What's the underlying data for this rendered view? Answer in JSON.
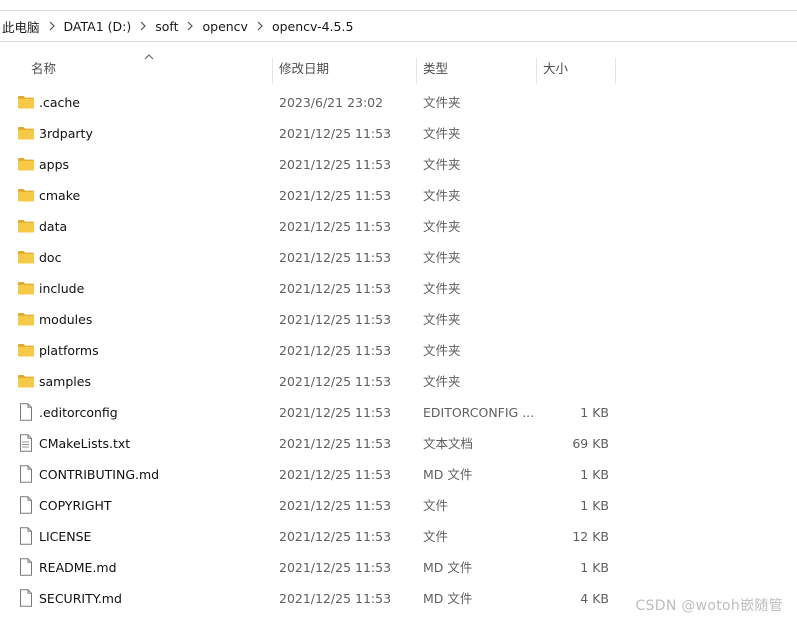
{
  "breadcrumb": {
    "items": [
      "此电脑",
      "DATA1 (D:)",
      "soft",
      "opencv",
      "opencv-4.5.5"
    ]
  },
  "columns": {
    "name": "名称",
    "date": "修改日期",
    "type": "类型",
    "size": "大小"
  },
  "files": [
    {
      "name": ".cache",
      "date": "2023/6/21 23:02",
      "type": "文件夹",
      "size": "",
      "icon": "folder-icon"
    },
    {
      "name": "3rdparty",
      "date": "2021/12/25 11:53",
      "type": "文件夹",
      "size": "",
      "icon": "folder-icon"
    },
    {
      "name": "apps",
      "date": "2021/12/25 11:53",
      "type": "文件夹",
      "size": "",
      "icon": "folder-icon"
    },
    {
      "name": "cmake",
      "date": "2021/12/25 11:53",
      "type": "文件夹",
      "size": "",
      "icon": "folder-icon"
    },
    {
      "name": "data",
      "date": "2021/12/25 11:53",
      "type": "文件夹",
      "size": "",
      "icon": "folder-icon"
    },
    {
      "name": "doc",
      "date": "2021/12/25 11:53",
      "type": "文件夹",
      "size": "",
      "icon": "folder-icon"
    },
    {
      "name": "include",
      "date": "2021/12/25 11:53",
      "type": "文件夹",
      "size": "",
      "icon": "folder-icon"
    },
    {
      "name": "modules",
      "date": "2021/12/25 11:53",
      "type": "文件夹",
      "size": "",
      "icon": "folder-icon"
    },
    {
      "name": "platforms",
      "date": "2021/12/25 11:53",
      "type": "文件夹",
      "size": "",
      "icon": "folder-icon"
    },
    {
      "name": "samples",
      "date": "2021/12/25 11:53",
      "type": "文件夹",
      "size": "",
      "icon": "folder-icon"
    },
    {
      "name": ".editorconfig",
      "date": "2021/12/25 11:53",
      "type": "EDITORCONFIG ...",
      "size": "1 KB",
      "icon": "file-icon"
    },
    {
      "name": "CMakeLists.txt",
      "date": "2021/12/25 11:53",
      "type": "文本文档",
      "size": "69 KB",
      "icon": "text-file-icon"
    },
    {
      "name": "CONTRIBUTING.md",
      "date": "2021/12/25 11:53",
      "type": "MD 文件",
      "size": "1 KB",
      "icon": "file-icon"
    },
    {
      "name": "COPYRIGHT",
      "date": "2021/12/25 11:53",
      "type": "文件",
      "size": "1 KB",
      "icon": "file-icon"
    },
    {
      "name": "LICENSE",
      "date": "2021/12/25 11:53",
      "type": "文件",
      "size": "12 KB",
      "icon": "file-icon"
    },
    {
      "name": "README.md",
      "date": "2021/12/25 11:53",
      "type": "MD 文件",
      "size": "1 KB",
      "icon": "file-icon"
    },
    {
      "name": "SECURITY.md",
      "date": "2021/12/25 11:53",
      "type": "MD 文件",
      "size": "4 KB",
      "icon": "file-icon"
    }
  ],
  "watermark": "CSDN @wotoh嵌随管",
  "colors": {
    "folder": "#f7c948",
    "folder_dark": "#e0a92a",
    "file_outline": "#7a7a7a"
  }
}
